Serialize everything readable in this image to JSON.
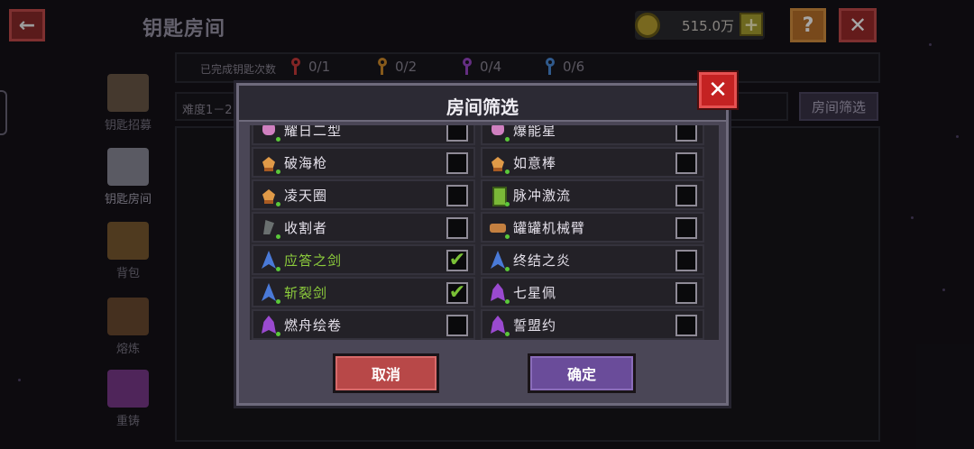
{
  "header": {
    "title": "钥匙房间",
    "coins": "515.0万",
    "plus": "+",
    "help": "?",
    "close": "✕",
    "back": "←"
  },
  "stats": {
    "label": "已完成钥匙次数",
    "keys": [
      {
        "value": "0/1",
        "color": "#c83a3a"
      },
      {
        "value": "0/2",
        "color": "#d08a2a"
      },
      {
        "value": "0/4",
        "color": "#9a48c8"
      },
      {
        "value": "0/6",
        "color": "#4a8ad8"
      }
    ]
  },
  "side_nav": [
    {
      "label": "钥匙招募",
      "color": "#6a5848"
    },
    {
      "label": "钥匙房间",
      "color": "#8a8a98"
    },
    {
      "label": "背包",
      "color": "#7a5a30"
    },
    {
      "label": "熔炼",
      "color": "#6a4a30"
    },
    {
      "label": "重铸",
      "color": "#7a3a8a"
    }
  ],
  "difficulty_tab": "难度1－2",
  "room_filter_button": "房间筛选",
  "modal": {
    "title": "房间筛选",
    "close": "✕",
    "cancel": "取消",
    "confirm": "确定",
    "rows": [
      {
        "left": {
          "name": "耀日二型",
          "icon": "bunny",
          "checked": false
        },
        "right": {
          "name": "爆能星",
          "icon": "bunny",
          "checked": false
        }
      },
      {
        "left": {
          "name": "破海枪",
          "icon": "creature",
          "checked": false
        },
        "right": {
          "name": "如意棒",
          "icon": "creature",
          "checked": false
        }
      },
      {
        "left": {
          "name": "凌天圈",
          "icon": "creature",
          "checked": false
        },
        "right": {
          "name": "脉冲激流",
          "icon": "green",
          "checked": false
        }
      },
      {
        "left": {
          "name": "收割者",
          "icon": "scythe",
          "checked": false
        },
        "right": {
          "name": "罐罐机械臂",
          "icon": "mech",
          "checked": false
        }
      },
      {
        "left": {
          "name": "应答之剑",
          "icon": "blue",
          "checked": true
        },
        "right": {
          "name": "终结之炎",
          "icon": "blue",
          "checked": false
        }
      },
      {
        "left": {
          "name": "斩裂剑",
          "icon": "blue",
          "checked": true
        },
        "right": {
          "name": "七星佩",
          "icon": "purple",
          "checked": false
        }
      },
      {
        "left": {
          "name": "燃舟绘卷",
          "icon": "purple",
          "checked": false
        },
        "right": {
          "name": "誓盟约",
          "icon": "purple",
          "checked": false
        }
      }
    ],
    "check_glyph": "✔"
  }
}
